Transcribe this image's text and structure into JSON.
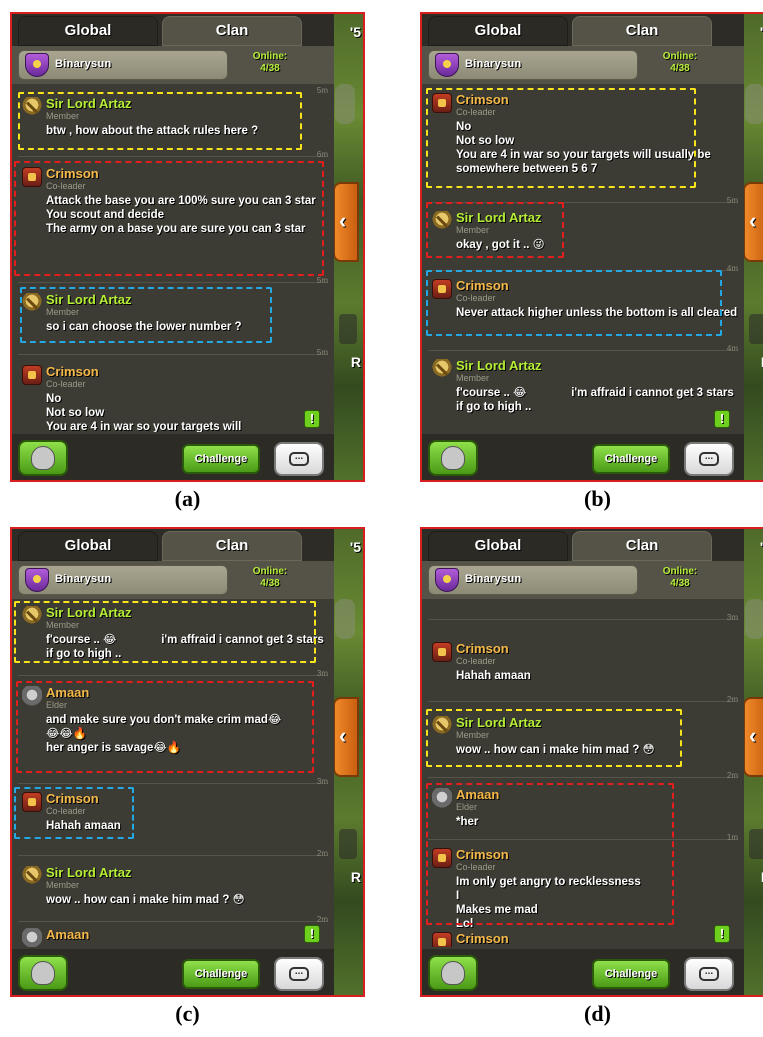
{
  "ui": {
    "tab_global": "Global",
    "tab_clan": "Clan",
    "clan_name": "Binarysun",
    "online_label": "Online:",
    "online_count": "4/38",
    "challenge_label": "Challenge",
    "side_label_top": "'5",
    "side_label_mid": "R"
  },
  "roles": {
    "member": "Member",
    "coleader": "Co-leader",
    "elder": "Elder"
  },
  "panels": [
    {
      "caption": "(a)",
      "messages": [
        {
          "time": "5m",
          "author": "Sir Lord Artaz",
          "role": "Member",
          "text": "btw , how about the attack rules here ?"
        },
        {
          "time": "6m",
          "author": "Crimson",
          "role": "Co-leader",
          "text": "Attack the base you are 100% sure you can 3 star\nYou scout and decide\nThe army on a base you are sure you can 3 star"
        },
        {
          "time": "5m",
          "author": "Sir Lord Artaz",
          "role": "Member",
          "text": "so i can choose the lower number ?"
        },
        {
          "time": "5m",
          "author": "Crimson",
          "role": "Co-leader",
          "text": "No\nNot so low\nYou are 4 in war so your targets will"
        }
      ]
    },
    {
      "caption": "(b)",
      "messages": [
        {
          "time": "",
          "author": "Crimson",
          "role": "Co-leader",
          "text": "No\nNot so low\nYou are 4 in war so your targets will usually be somewhere between 5 6 7"
        },
        {
          "time": "5m",
          "author": "Sir Lord Artaz",
          "role": "Member",
          "text": "okay , got it .. 😜"
        },
        {
          "time": "4m",
          "author": "Crimson",
          "role": "Co-leader",
          "text": "Never attack higher unless the bottom is all cleared"
        },
        {
          "time": "4m",
          "author": "Sir Lord Artaz",
          "role": "Member",
          "text": "f'course .. 😂              i'm affraid i cannot get 3 stars if go to high .."
        }
      ]
    },
    {
      "caption": "(c)",
      "messages": [
        {
          "time": "",
          "author": "Sir Lord Artaz",
          "role": "Member",
          "text": "f'course .. 😂              i'm affraid i cannot get 3 stars if go to high .."
        },
        {
          "time": "3m",
          "author": "Amaan",
          "role": "Elder",
          "text": "and make sure you don't make crim mad😂\n😂😂🔥\nher anger is savage😂🔥"
        },
        {
          "time": "3m",
          "author": "Crimson",
          "role": "Co-leader",
          "text": "Hahah amaan"
        },
        {
          "time": "2m",
          "author": "Sir Lord Artaz",
          "role": "Member",
          "text": "wow .. how can i make him mad ? 😳"
        },
        {
          "time": "2m",
          "author": "Amaan",
          "role": "Elder",
          "text": ""
        }
      ]
    },
    {
      "caption": "(d)",
      "messages": [
        {
          "time": "3m",
          "author": "Crimson",
          "role": "Co-leader",
          "text": "Hahah amaan"
        },
        {
          "time": "2m",
          "author": "Sir Lord Artaz",
          "role": "Member",
          "text": "wow .. how can i make him mad ? 😳"
        },
        {
          "time": "2m",
          "author": "Amaan",
          "role": "Elder",
          "text": "*her"
        },
        {
          "time": "1m",
          "author": "Crimson",
          "role": "Co-leader",
          "text": "Im only get angry to recklessness\nI\nMakes me mad\nLol"
        },
        {
          "time": "",
          "author": "Crimson",
          "role": "Co-leader",
          "text": ""
        }
      ]
    }
  ],
  "highlight_colors": {
    "yellow": "#f7e41c",
    "red": "#e41d1d",
    "blue": "#23a8e3"
  }
}
